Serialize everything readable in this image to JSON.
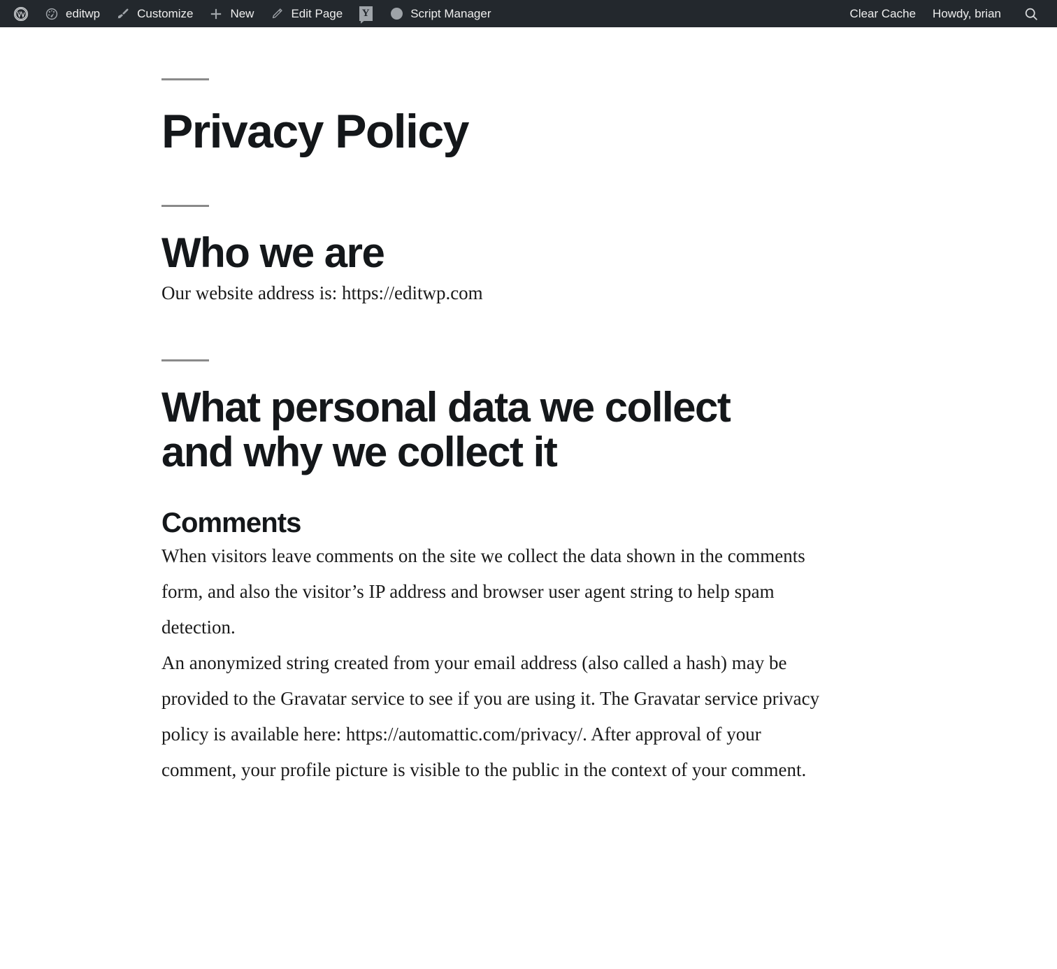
{
  "adminbar": {
    "left_items": [
      {
        "icon": "wordpress-logo-icon",
        "label": "",
        "name": "adminbar-wp-logo"
      },
      {
        "icon": "dashboard-icon",
        "label": "editwp",
        "name": "adminbar-site-name"
      },
      {
        "icon": "paintbrush-icon",
        "label": "Customize",
        "name": "adminbar-customize"
      },
      {
        "icon": "plus-icon",
        "label": "New",
        "name": "adminbar-new"
      },
      {
        "icon": "pencil-icon",
        "label": "Edit Page",
        "name": "adminbar-edit-page"
      },
      {
        "icon": "yoast-seo-icon",
        "label": "",
        "name": "adminbar-yoast-seo"
      },
      {
        "icon": "circle-icon",
        "label": "Script Manager",
        "name": "adminbar-script-manager"
      }
    ],
    "right_items": [
      {
        "label": "Clear Cache",
        "name": "adminbar-clear-cache"
      },
      {
        "label": "Howdy, brian",
        "name": "adminbar-my-account"
      }
    ],
    "search_icon": "search-icon",
    "background_color": "#23282d",
    "text_color": "#eeeeee"
  },
  "page": {
    "title": "Privacy Policy",
    "sections": [
      {
        "heading": "Who we are",
        "paragraphs": [
          "Our website address is: https://editwp.com"
        ]
      },
      {
        "heading": "What personal data we collect and why we collect it",
        "subheading": "Comments",
        "paragraphs": [
          "When visitors leave comments on the site we collect the data shown in the comments form, and also the visitor’s IP address and browser user agent string to help spam detection.",
          "An anonymized string created from your email address (also called a hash) may be provided to the Gravatar service to see if you are using it. The Gravatar service privacy policy is available here: https://automattic.com/privacy/. After approval of your comment, your profile picture is visible to the public in the context of your comment."
        ]
      }
    ],
    "rule_color": "#8a8a8a",
    "heading_color": "#14171a",
    "body_color": "#1a1a1a"
  }
}
